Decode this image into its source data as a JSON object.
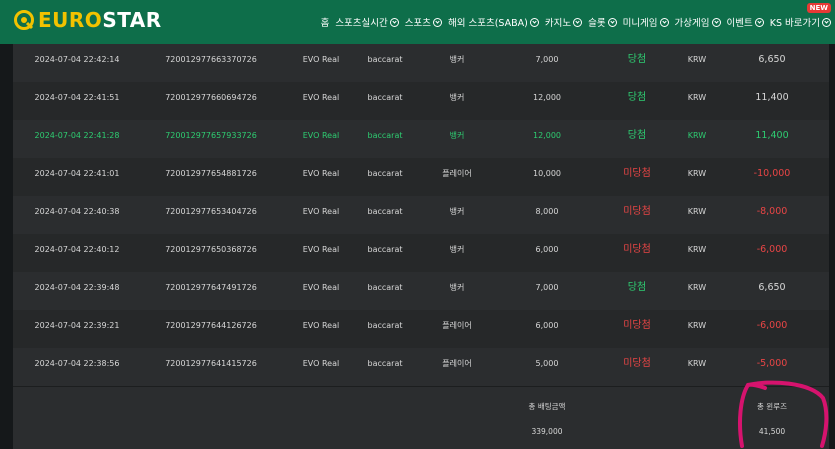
{
  "brand": {
    "name_part1": "EURO",
    "name_part2": "STAR"
  },
  "nav": [
    {
      "label": "홈",
      "chevron": false
    },
    {
      "label": "스포츠실시간",
      "chevron": true
    },
    {
      "label": "스포츠",
      "chevron": true
    },
    {
      "label": "해외 스포츠(SABA)",
      "chevron": true
    },
    {
      "label": "카지노",
      "chevron": true
    },
    {
      "label": "슬롯",
      "chevron": true
    },
    {
      "label": "미니게임",
      "chevron": true
    },
    {
      "label": "가상게임",
      "chevron": true
    },
    {
      "label": "이벤트",
      "chevron": true
    },
    {
      "label": "KS 바로가기",
      "chevron": true,
      "badge": "NEW"
    }
  ],
  "rows": [
    {
      "datetime": "2024-07-04 22:42:14",
      "id": "720012977663370726",
      "provider": "EVO Real",
      "game": "baccarat",
      "bet_on": "뱅커",
      "amount": "7,000",
      "result": "당첨",
      "result_type": "win",
      "currency": "KRW",
      "winloss": "6,650",
      "negative": false,
      "highlight": false
    },
    {
      "datetime": "2024-07-04 22:41:51",
      "id": "720012977660694726",
      "provider": "EVO Real",
      "game": "baccarat",
      "bet_on": "뱅커",
      "amount": "12,000",
      "result": "당첨",
      "result_type": "win",
      "currency": "KRW",
      "winloss": "11,400",
      "negative": false,
      "highlight": false
    },
    {
      "datetime": "2024-07-04 22:41:28",
      "id": "720012977657933726",
      "provider": "EVO Real",
      "game": "baccarat",
      "bet_on": "뱅커",
      "amount": "12,000",
      "result": "당첨",
      "result_type": "win",
      "currency": "KRW",
      "winloss": "11,400",
      "negative": false,
      "highlight": true
    },
    {
      "datetime": "2024-07-04 22:41:01",
      "id": "720012977654881726",
      "provider": "EVO Real",
      "game": "baccarat",
      "bet_on": "플레이어",
      "amount": "10,000",
      "result": "미당첨",
      "result_type": "lose",
      "currency": "KRW",
      "winloss": "-10,000",
      "negative": true,
      "highlight": false
    },
    {
      "datetime": "2024-07-04 22:40:38",
      "id": "720012977653404726",
      "provider": "EVO Real",
      "game": "baccarat",
      "bet_on": "뱅커",
      "amount": "8,000",
      "result": "미당첨",
      "result_type": "lose",
      "currency": "KRW",
      "winloss": "-8,000",
      "negative": true,
      "highlight": false
    },
    {
      "datetime": "2024-07-04 22:40:12",
      "id": "720012977650368726",
      "provider": "EVO Real",
      "game": "baccarat",
      "bet_on": "뱅커",
      "amount": "6,000",
      "result": "미당첨",
      "result_type": "lose",
      "currency": "KRW",
      "winloss": "-6,000",
      "negative": true,
      "highlight": false
    },
    {
      "datetime": "2024-07-04 22:39:48",
      "id": "720012977647491726",
      "provider": "EVO Real",
      "game": "baccarat",
      "bet_on": "뱅커",
      "amount": "7,000",
      "result": "당첨",
      "result_type": "win",
      "currency": "KRW",
      "winloss": "6,650",
      "negative": false,
      "highlight": false
    },
    {
      "datetime": "2024-07-04 22:39:21",
      "id": "720012977644126726",
      "provider": "EVO Real",
      "game": "baccarat",
      "bet_on": "플레이어",
      "amount": "6,000",
      "result": "미당첨",
      "result_type": "lose",
      "currency": "KRW",
      "winloss": "-6,000",
      "negative": true,
      "highlight": false
    },
    {
      "datetime": "2024-07-04 22:38:56",
      "id": "720012977641415726",
      "provider": "EVO Real",
      "game": "baccarat",
      "bet_on": "플레이어",
      "amount": "5,000",
      "result": "미당첨",
      "result_type": "lose",
      "currency": "KRW",
      "winloss": "-5,000",
      "negative": true,
      "highlight": false
    }
  ],
  "summary": {
    "total_bet_label": "총 배팅금액",
    "total_bet_value": "339,000",
    "total_winloss_label": "총 윈루즈",
    "total_winloss_value": "41,500"
  },
  "colors": {
    "header_bg": "#0e6e4a",
    "win": "#2ecc71",
    "lose": "#e84545",
    "annotation": "#d6136e"
  }
}
